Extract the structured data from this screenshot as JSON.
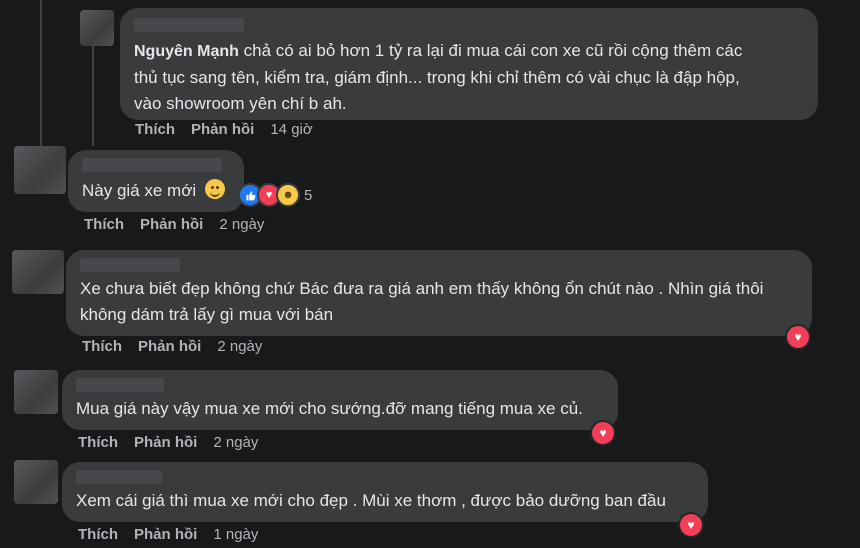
{
  "comments": [
    {
      "author": "Nguyên Mạnh",
      "lines": [
        " chả có ai bỏ hơn 1 tỷ ra lại đi mua cái con xe cũ rồi cộng thêm các",
        "thủ tục sang tên, kiểm tra, giám định... trong khi chỉ thêm có vài chục là đập hộp,",
        "vào showroom yên chí b ah."
      ],
      "like": "Thích",
      "reply": "Phản hồi",
      "time": "14 giờ"
    },
    {
      "author": "",
      "lines": [
        "Này giá xe mới"
      ],
      "like": "Thích",
      "reply": "Phản hồi",
      "time": "2 ngày",
      "reaction_count": "5",
      "reactions": [
        "like-icon",
        "love-icon",
        "haha-icon"
      ]
    },
    {
      "author": "",
      "lines": [
        "Xe chưa biết đẹp không chứ Bác đưa ra giá anh em thấy không ổn chút nào . Nhìn giá thôi",
        "không dám trả lấy gì mua với bán"
      ],
      "like": "Thích",
      "reply": "Phản hồi",
      "time": "2 ngày",
      "reactions": [
        "love-icon"
      ]
    },
    {
      "author": "",
      "lines": [
        "Mua giá này vậy mua xe mới cho sướng.đỡ mang tiếng mua xe củ."
      ],
      "like": "Thích",
      "reply": "Phản hồi",
      "time": "2 ngày",
      "reactions": [
        "love-icon"
      ]
    },
    {
      "author": "",
      "lines": [
        "Xem cái giá thì mua xe mới cho đẹp . Mùi xe thơm , được bảo dưỡng ban đầu"
      ],
      "like": "Thích",
      "reply": "Phản hồi",
      "time": "1 ngày",
      "reactions": [
        "love-icon"
      ]
    }
  ],
  "colors": {
    "background": "#18191a",
    "bubble": "#3a3b3c",
    "text": "#e4e6eb",
    "muted": "#b0b3b8",
    "love": "#f33e58",
    "like": "#2078f4",
    "haha": "#f7c948"
  }
}
